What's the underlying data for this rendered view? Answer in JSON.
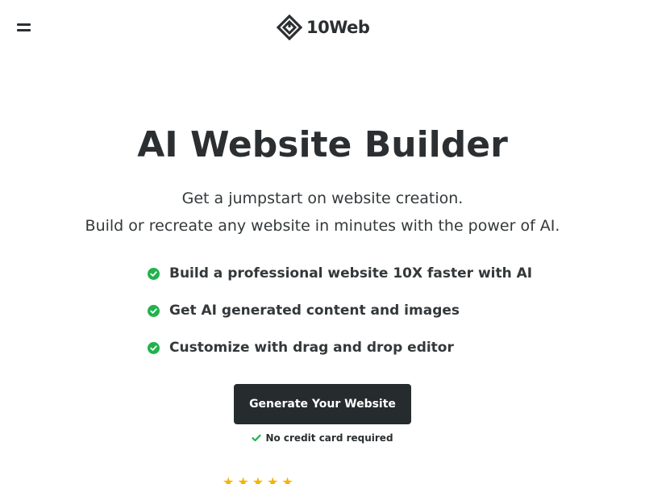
{
  "header": {
    "logo_text": "10Web",
    "menu_icon": "hamburger-menu-icon",
    "logo_icon": "10web-diamond-logo-icon"
  },
  "hero": {
    "title": "AI Website Builder",
    "subtitle_line1": "Get a jumpstart on website creation.",
    "subtitle_line2": "Build or recreate any website in minutes with the power of AI."
  },
  "features": [
    {
      "icon": "check-circle-icon",
      "text": "Build a professional website 10X faster with AI"
    },
    {
      "icon": "check-circle-icon",
      "text": "Get AI generated content and images"
    },
    {
      "icon": "check-circle-icon",
      "text": "Customize with drag and drop editor"
    }
  ],
  "cta": {
    "label": "Generate Your Website",
    "note": "No credit card required",
    "note_icon": "checkmark-icon"
  },
  "rating": {
    "stars": 5
  },
  "colors": {
    "text_dark": "#2b2f31",
    "button_bg": "#262b2d",
    "check_green": "#22b24c",
    "star_gold": "#f5b400"
  }
}
